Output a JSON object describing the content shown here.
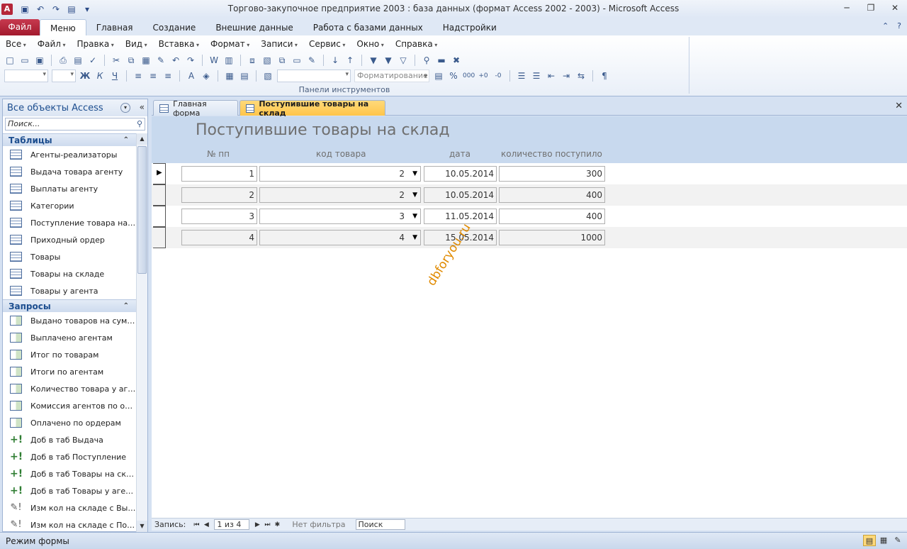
{
  "window": {
    "title": "Торгово-закупочное предприятие 2003 : база данных (формат Access 2002 - 2003)  -  Microsoft Access",
    "app_icon_letter": "A"
  },
  "ribbon": {
    "file_tab": "Файл",
    "tabs": [
      "Меню",
      "Главная",
      "Создание",
      "Внешние данные",
      "Работа с базами данных",
      "Надстройки"
    ],
    "active_tab": "Меню",
    "menus": [
      "Все",
      "Файл",
      "Правка",
      "Вид",
      "Вставка",
      "Формат",
      "Записи",
      "Сервис",
      "Окно",
      "Справка"
    ],
    "format_combo": "Форматирование",
    "group_label": "Панели инструментов"
  },
  "nav": {
    "header": "Все объекты Access",
    "search_placeholder": "Поиск...",
    "groups": [
      {
        "title": "Таблицы",
        "items": [
          {
            "label": "Агенты-реализаторы",
            "icon": "table-icon"
          },
          {
            "label": "Выдача товара агенту",
            "icon": "table-icon"
          },
          {
            "label": "Выплаты агенту",
            "icon": "table-icon"
          },
          {
            "label": "Категории",
            "icon": "table-icon"
          },
          {
            "label": "Поступление товара на с...",
            "icon": "table-icon"
          },
          {
            "label": "Приходный ордер",
            "icon": "table-icon"
          },
          {
            "label": "Товары",
            "icon": "table-icon"
          },
          {
            "label": "Товары на складе",
            "icon": "table-icon"
          },
          {
            "label": "Товары у агента",
            "icon": "table-icon"
          }
        ]
      },
      {
        "title": "Запросы",
        "items": [
          {
            "label": "Выдано товаров на сумму",
            "icon": "query-icon"
          },
          {
            "label": "Выплачено агентам",
            "icon": "query-icon"
          },
          {
            "label": "Итог по товарам",
            "icon": "query-icon"
          },
          {
            "label": "Итоги по агентам",
            "icon": "query-icon"
          },
          {
            "label": "Количество товара у аге...",
            "icon": "query-icon"
          },
          {
            "label": "Комиссия агентов по ор...",
            "icon": "query-icon"
          },
          {
            "label": "Оплачено по ордерам",
            "icon": "query-icon"
          },
          {
            "label": "Доб в таб Выдача",
            "icon": "append-query-icon"
          },
          {
            "label": "Доб в таб Поступление",
            "icon": "append-query-icon"
          },
          {
            "label": "Доб в таб Товары на скл...",
            "icon": "append-query-icon"
          },
          {
            "label": "Доб в таб Товары у агента",
            "icon": "append-query-icon"
          },
          {
            "label": "Изм кол на складе с Выда...",
            "icon": "update-query-icon"
          },
          {
            "label": "Изм кол на складе с Пост...",
            "icon": "update-query-icon"
          }
        ]
      }
    ]
  },
  "doc_tabs": [
    {
      "label": "Главная форма",
      "active": false
    },
    {
      "label": "Поступившие товары на склад",
      "active": true
    }
  ],
  "form": {
    "title": "Поступившие товары на склад",
    "columns": [
      "№ пп",
      "код товара",
      "дата",
      "количество поступило"
    ],
    "rows": [
      {
        "num": "1",
        "code": "2",
        "date": "10.05.2014",
        "qty": "300"
      },
      {
        "num": "2",
        "code": "2",
        "date": "10.05.2014",
        "qty": "400"
      },
      {
        "num": "3",
        "code": "3",
        "date": "11.05.2014",
        "qty": "400"
      },
      {
        "num": "4",
        "code": "4",
        "date": "15.05.2014",
        "qty": "1000"
      }
    ],
    "watermark": "dbforyou.ru"
  },
  "record_nav": {
    "label": "Запись:",
    "current": "1 из 4",
    "filter": "Нет фильтра",
    "search": "Поиск"
  },
  "status": {
    "text": "Режим формы"
  }
}
